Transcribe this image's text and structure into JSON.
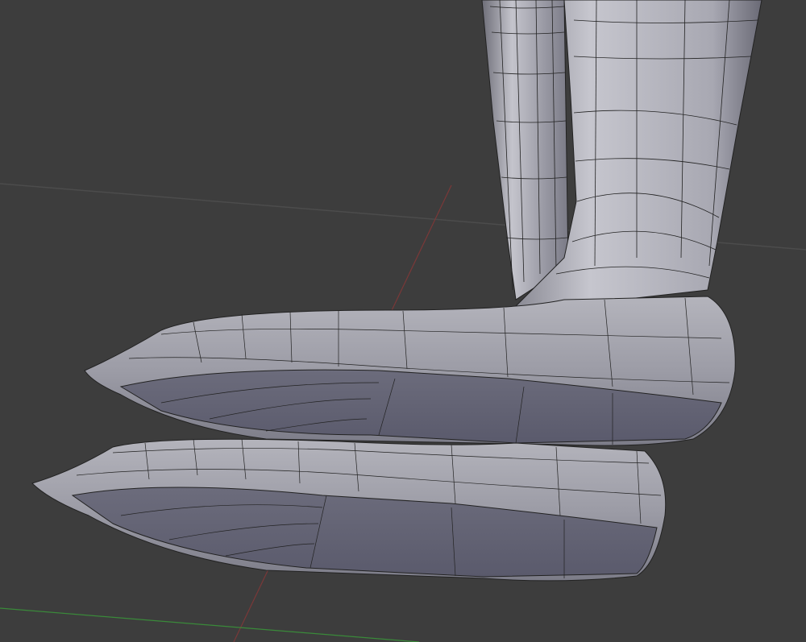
{
  "viewport": {
    "background_color": "#3d3d3d",
    "grid_color": "#4a4a4a",
    "x_axis_color": "#8a3a3a",
    "y_axis_color": "#3f8a3f",
    "mesh_color": "#9a9aa8",
    "wire_color": "#1e1e22"
  }
}
